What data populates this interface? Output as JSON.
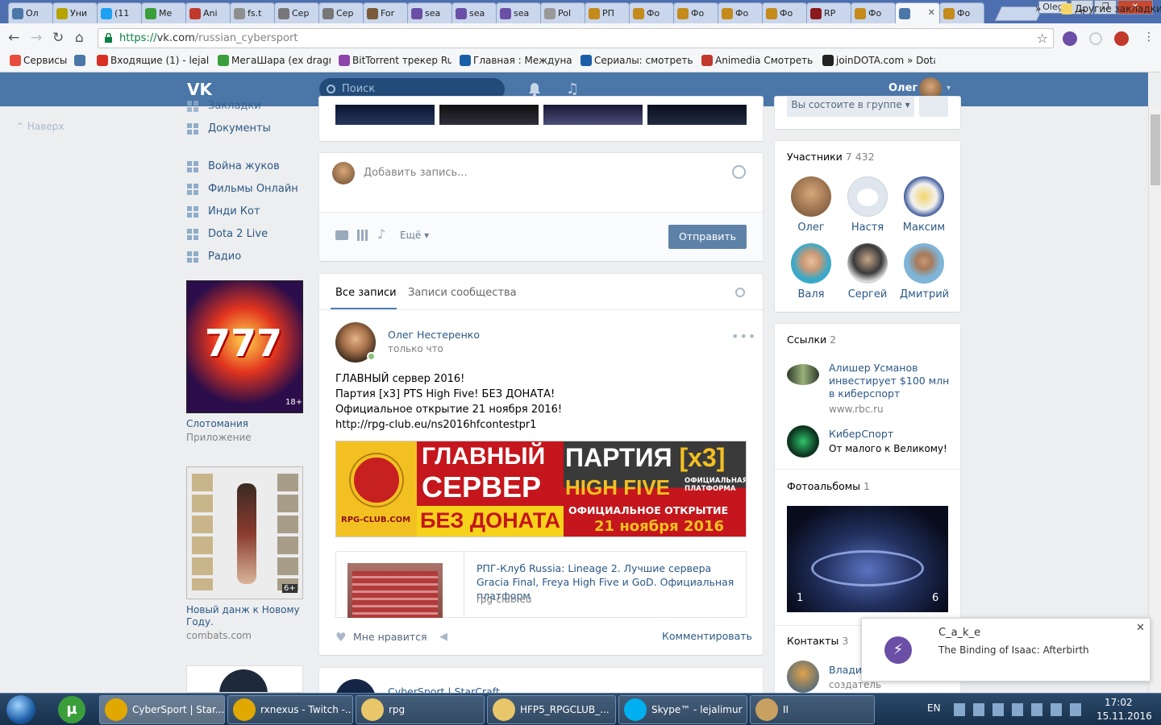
{
  "browser": {
    "tabs": [
      {
        "label": "Ол",
        "color": "#4a76a8"
      },
      {
        "label": "Уни",
        "color": "#b5a400"
      },
      {
        "label": "(11",
        "color": "#1da1f2"
      },
      {
        "label": "Ме",
        "color": "#3a9e3a"
      },
      {
        "label": "Ani",
        "color": "#c0392b"
      },
      {
        "label": "fs.t",
        "color": "#8e8e8e"
      },
      {
        "label": "Сер",
        "color": "#777"
      },
      {
        "label": "Сер",
        "color": "#777"
      },
      {
        "label": "For",
        "color": "#7a5a3a"
      },
      {
        "label": "sea",
        "color": "#6b4fa6"
      },
      {
        "label": "sea",
        "color": "#6b4fa6"
      },
      {
        "label": "sea",
        "color": "#6b4fa6"
      },
      {
        "label": "Pol",
        "color": "#999"
      },
      {
        "label": "РП",
        "color": "#c48a1a"
      },
      {
        "label": "Фо",
        "color": "#c48a1a"
      },
      {
        "label": "Фо",
        "color": "#c48a1a"
      },
      {
        "label": "Фо",
        "color": "#c48a1a"
      },
      {
        "label": "Фо",
        "color": "#c48a1a"
      },
      {
        "label": "RP",
        "color": "#8b1a1a"
      },
      {
        "label": "Фо",
        "color": "#c48a1a"
      },
      {
        "label": "",
        "color": "#4a76a8",
        "active": true
      },
      {
        "label": "Фо",
        "color": "#c48a1a"
      }
    ],
    "profile_name": "Oleg",
    "url_protocol": "https://",
    "url_host": "vk.com",
    "url_path": "/russian_cybersport",
    "bookmarks": [
      {
        "label": "Сервисы",
        "color": "#e74c3c"
      },
      {
        "label": "",
        "color": "#4a76a8"
      },
      {
        "label": "Входящие (1) - lejalim",
        "color": "#d93025"
      },
      {
        "label": "МегаШара (ex dragm",
        "color": "#3a9e3a"
      },
      {
        "label": "BitTorrent трекер RuT",
        "color": "#8e44ad"
      },
      {
        "label": "Главная : Междунар",
        "color": "#1a5ea8"
      },
      {
        "label": "Сериалы: смотреть с",
        "color": "#1a5ea8"
      },
      {
        "label": "Animedia Смотреть А",
        "color": "#c0392b"
      },
      {
        "label": "joinDOTA.com » Dota",
        "color": "#222"
      }
    ],
    "bookmarks_more": "»",
    "other_bookmarks": "Другие закладки"
  },
  "vk": {
    "search_placeholder": "Поиск",
    "user_name": "Олег",
    "back_to_top": "Наверх",
    "menu": [
      {
        "label": "Закладки"
      },
      {
        "label": "Документы"
      },
      {
        "label": "Война жуков"
      },
      {
        "label": "Фильмы Онлайн"
      },
      {
        "label": "Инди Кот"
      },
      {
        "label": "Dota 2 Live"
      },
      {
        "label": "Радио"
      }
    ],
    "ads": [
      {
        "title": "Слотомания",
        "sub": "Приложение",
        "age": "18+"
      },
      {
        "title": "Новый данж к Новому Году.",
        "sub": "combats.com",
        "age": "6+"
      }
    ],
    "composer": {
      "placeholder": "Добавить запись...",
      "more": "Ещё",
      "send": "Отправить"
    },
    "wall_tabs": {
      "all": "Все записи",
      "community": "Записи сообщества"
    },
    "post": {
      "author": "Олег Нестеренко",
      "time": "только что",
      "lines": [
        "ГЛАВНЫЙ сервер 2016!",
        "Партия [x3] PTS High Five! БЕЗ ДОНАТА!",
        "Официальное открытие 21 ноября 2016!"
      ],
      "link": "http://rpg-club.eu/ns2016hfcontestpr1",
      "banner": {
        "l1": "ГЛАВНЫЙ",
        "l2": "СЕРВЕР",
        "l3": "БЕЗ ДОНАТА",
        "logo": "RPG-CLUB.COM",
        "r1": "ПАРТИЯ",
        "r1b": "[x3]",
        "r2": "HIGH FIVE",
        "r2s": "ОФИЦИАЛЬНАЯ ПЛАТФОРМА",
        "r3": "ОФИЦИАЛЬНОЕ ОТКРЫТИЕ",
        "r4": "21 ноября 2016"
      },
      "snippet_title": "РПГ-Клуб Russia: Lineage 2. Лучшие сервера Gracia Final, Freya High Five и GoD. Официальная платформ",
      "snippet_domain": "rpg-club.eu",
      "like": "Мне нравится",
      "comment": "Комментировать"
    },
    "next_post_author": "CyberSport | StarCraft",
    "join_button": "Вы состоите в группе",
    "members": {
      "title": "Участники",
      "count": "7 432",
      "people": [
        {
          "name": "Олег",
          "c1": "#6b4a2e",
          "c2": "#d8a77a"
        },
        {
          "name": "Настя",
          "c1": "#dfe6ee",
          "c2": "#b7c6d6"
        },
        {
          "name": "Максим",
          "c1": "#f1f1f1",
          "c2": "#1b3c8a"
        },
        {
          "name": "Валя",
          "c1": "#3aa9c9",
          "c2": "#e8c39e"
        },
        {
          "name": "Сергей",
          "c1": "#d9d9d9",
          "c2": "#3a3a3a"
        },
        {
          "name": "Дмитрий",
          "c1": "#7fb5d8",
          "c2": "#c99874"
        }
      ]
    },
    "links": {
      "title": "Ссылки",
      "count": "2",
      "items": [
        {
          "title": "Алишер Усманов инвестирует $100 млн в киберспорт",
          "sub": "www.rbc.ru"
        },
        {
          "title": "КиберСпорт",
          "sub": "От малого к Великому!"
        }
      ]
    },
    "albums": {
      "title": "Фотоальбомы",
      "count": "1",
      "left": "1",
      "right": "6"
    },
    "contacts": {
      "title": "Контакты",
      "count": "3",
      "name": "Влади",
      "role": "создатель"
    }
  },
  "toast": {
    "title": "C_a_k_e",
    "body": "The Binding of Isaac: Afterbirth"
  },
  "taskbar": {
    "items": [
      {
        "label": "CyberSport | Star...",
        "color": "#e0a800"
      },
      {
        "label": "rxnexus - Twitch -...",
        "color": "#e0a800"
      },
      {
        "label": "rpg",
        "color": "#e8c66a"
      },
      {
        "label": "HFP5_RPGCLUB_...",
        "color": "#e8c66a"
      },
      {
        "label": "Skype™ - lejalimur",
        "color": "#00aff0"
      },
      {
        "label": "II",
        "color": "#c8a060"
      }
    ],
    "lang": "EN",
    "time": "17:02",
    "date": "15.11.2016"
  }
}
